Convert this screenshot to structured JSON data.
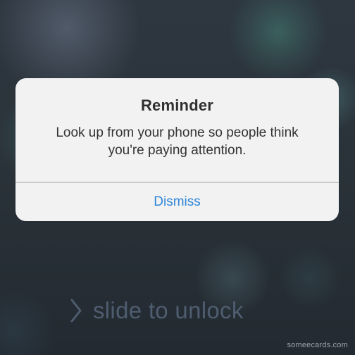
{
  "alert": {
    "title": "Reminder",
    "message": "Look up from your phone so people think you're paying attention.",
    "button_label": "Dismiss"
  },
  "lockscreen": {
    "slide_text": "slide to unlock",
    "chevron_icon": "chevron-right-icon"
  },
  "watermark": "someecards.com",
  "colors": {
    "accent": "#2f86d8",
    "alert_background": "#f2f2f2",
    "slide_text": "#4e5d6f"
  }
}
